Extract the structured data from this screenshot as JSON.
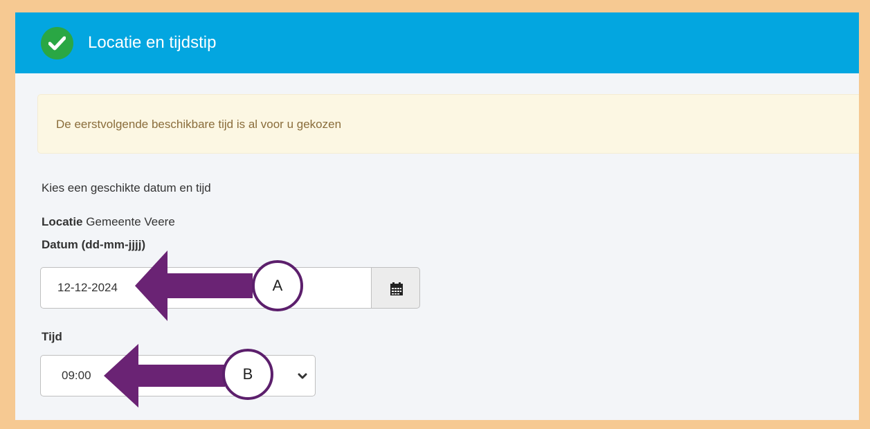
{
  "header": {
    "title": "Locatie en tijdstip",
    "icon": "check-circle-icon"
  },
  "alert": {
    "text": "De eerstvolgende beschikbare tijd is al voor u gekozen"
  },
  "form": {
    "intro": "Kies een geschikte datum en tijd",
    "location_label": "Locatie",
    "location_value": "Gemeente Veere",
    "date_label": "Datum (dd-mm-jjjj)",
    "date_value": "12-12-2024",
    "calendar_icon": "calendar-icon",
    "time_label": "Tijd",
    "time_value": "09:00"
  },
  "annotations": {
    "a": "A",
    "b": "B",
    "color": "#6a2374"
  },
  "colors": {
    "header_bg": "#03a6e0",
    "success": "#2aa744",
    "alert_bg": "#fcf7e3",
    "alert_text": "#8a6d3b",
    "frame": "#f6c992"
  }
}
